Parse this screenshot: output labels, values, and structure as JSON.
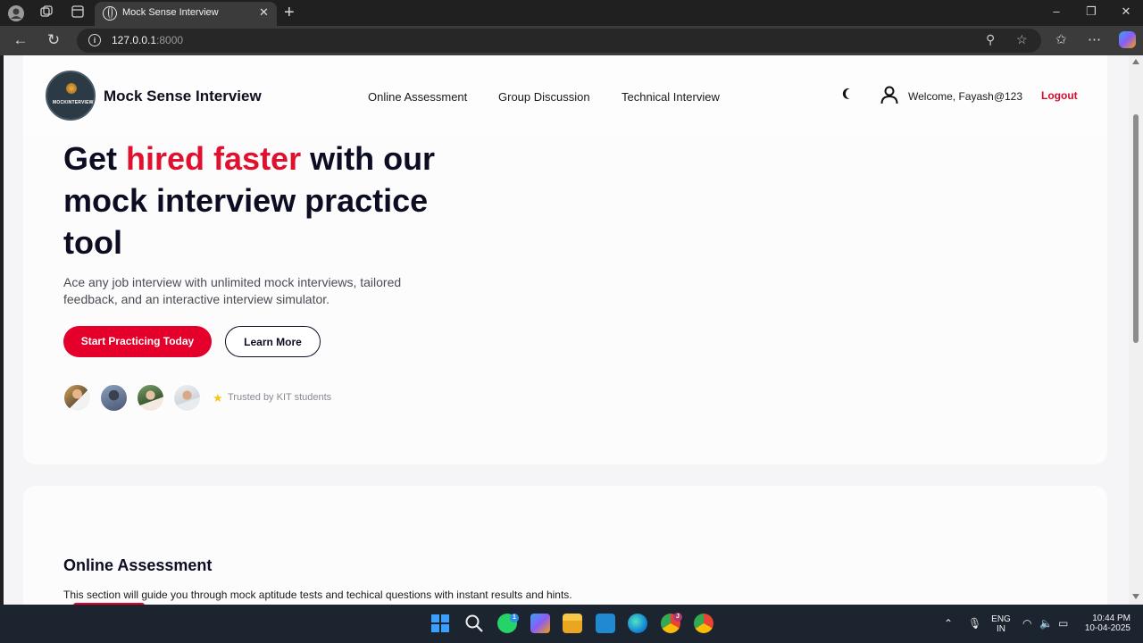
{
  "browser": {
    "tab_title": "Mock Sense Interview",
    "url_host": "127.0.0.1",
    "url_port": ":8000"
  },
  "site": {
    "logo_text": "MOCKINTERVIEW",
    "brand": "Mock Sense Interview",
    "nav": [
      "Online Assessment",
      "Group Discussion",
      "Technical Interview"
    ],
    "welcome": "Welcome, Fayash@123",
    "logout": "Logout"
  },
  "hero": {
    "title_part1": "Get ",
    "title_accent": "hired faster",
    "title_part2": " with our mock interview practice tool",
    "description": "Ace any job interview with unlimited mock interviews, tailored feedback, and an interactive interview simulator.",
    "primary_button": "Start Practicing Today",
    "secondary_button": "Learn More",
    "trusted": "Trusted by KIT students"
  },
  "section": {
    "title": "Online Assessment",
    "description": "This section will guide you through mock aptitude tests and techical questions with instant results and hints."
  },
  "taskbar": {
    "lang_top": "ENG",
    "lang_bottom": "IN",
    "time": "10:44 PM",
    "date": "10-04-2025",
    "whatsapp_badge": "1",
    "chrome_badge": "J"
  },
  "colors": {
    "accent": "#e4002b",
    "heading": "#0c0c22",
    "page_bg": "#f5f5f7"
  }
}
